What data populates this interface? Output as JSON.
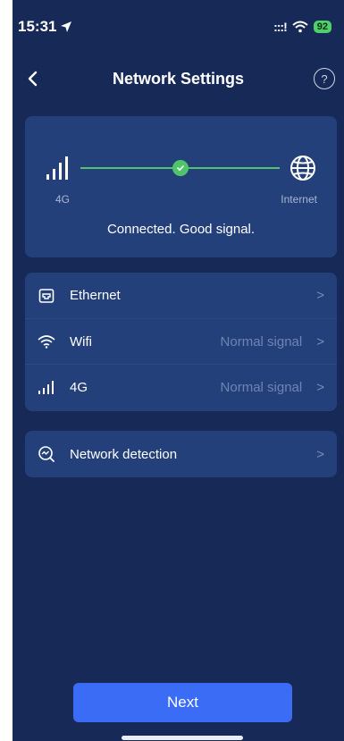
{
  "status_bar": {
    "time": "15:31",
    "signal": ":::!",
    "battery": "92"
  },
  "nav": {
    "title": "Network Settings",
    "help": "?"
  },
  "connection": {
    "source_label": "4G",
    "target_label": "Internet",
    "status_text": "Connected. Good signal.",
    "accent_color": "#4fc46a"
  },
  "network_list": [
    {
      "icon": "ethernet-icon",
      "label": "Ethernet",
      "value": ""
    },
    {
      "icon": "wifi-icon",
      "label": "Wifi",
      "value": "Normal signal"
    },
    {
      "icon": "cellular-signal-icon",
      "label": "4G",
      "value": "Normal signal"
    }
  ],
  "detection": {
    "icon": "network-detection-icon",
    "label": "Network detection"
  },
  "footer": {
    "next_label": "Next",
    "button_color": "#3b6cf5"
  }
}
